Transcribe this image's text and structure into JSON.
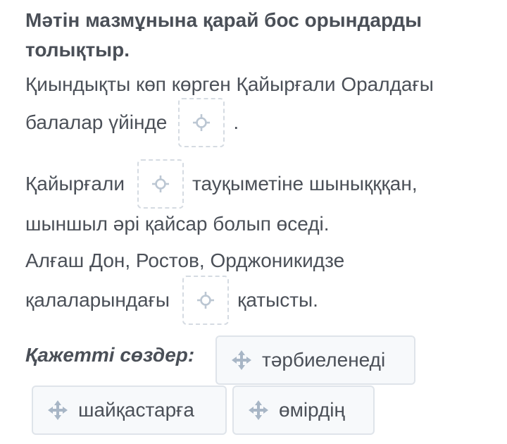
{
  "title": "Мәтін мазмұнына қарай бос орындарды толықтыр.",
  "sentences": {
    "s1_line1": "Қиындықты көп көрген Қайырғали Оралдағы",
    "s1_line2_before": "балалар үйінде",
    "s1_line2_after": ".",
    "s2_line1_before": "Қайырғали",
    "s2_line1_after": "тауқыметіне шынықққан,",
    "s2_line2": "шыншыл әрі қайсар болып өседі.",
    "s3_line1": "Алғаш Дон, Ростов, Орджоникидзе",
    "s3_line2_before": "қалаларындағы",
    "s3_line2_after": "қатысты."
  },
  "word_bank": {
    "label": "Қажетті сөздер:",
    "words": [
      "тәрбиеленеді",
      "шайқастарға",
      "өмірдің"
    ]
  },
  "colors": {
    "text": "#4b5058",
    "gap_border": "#d5dbe2",
    "gap_icon": "#bcc7d3",
    "chip_border": "#dfe4ea",
    "chip_bg": "#f7f9fb",
    "chip_icon": "#a8b6c6"
  },
  "icons": {
    "gap": "crosshair-icon",
    "chip": "move-icon"
  }
}
